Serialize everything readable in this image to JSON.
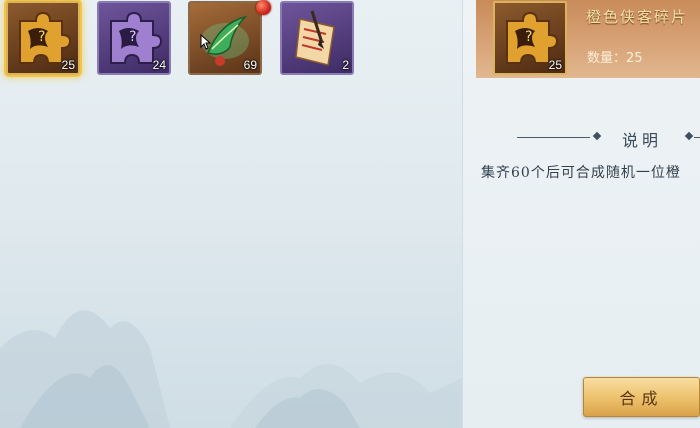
{
  "inventory": {
    "items": [
      {
        "name": "orange-hero-fragment",
        "count": "25",
        "rarity": "gold",
        "selected": true
      },
      {
        "name": "purple-hero-fragment",
        "count": "24",
        "rarity": "purple",
        "selected": false
      },
      {
        "name": "green-herb-item",
        "count": "69",
        "rarity": "gold",
        "selected": false,
        "has_red_dot": true
      },
      {
        "name": "scroll-and-brush-item",
        "count": "2",
        "rarity": "purple",
        "selected": false
      }
    ]
  },
  "detail": {
    "item_name": "橙色侠客碎片",
    "count": "25",
    "quantity_text": "数量：25"
  },
  "description": {
    "section_title": "说明",
    "text": "集齐60个后可合成随机一位橙"
  },
  "actions": {
    "compose_label": "合成"
  },
  "colors": {
    "gold_border": "#d9b45a",
    "purple_border": "#8b7bb3",
    "button_gold": "#ecc06a",
    "text_dark": "#33414e"
  }
}
